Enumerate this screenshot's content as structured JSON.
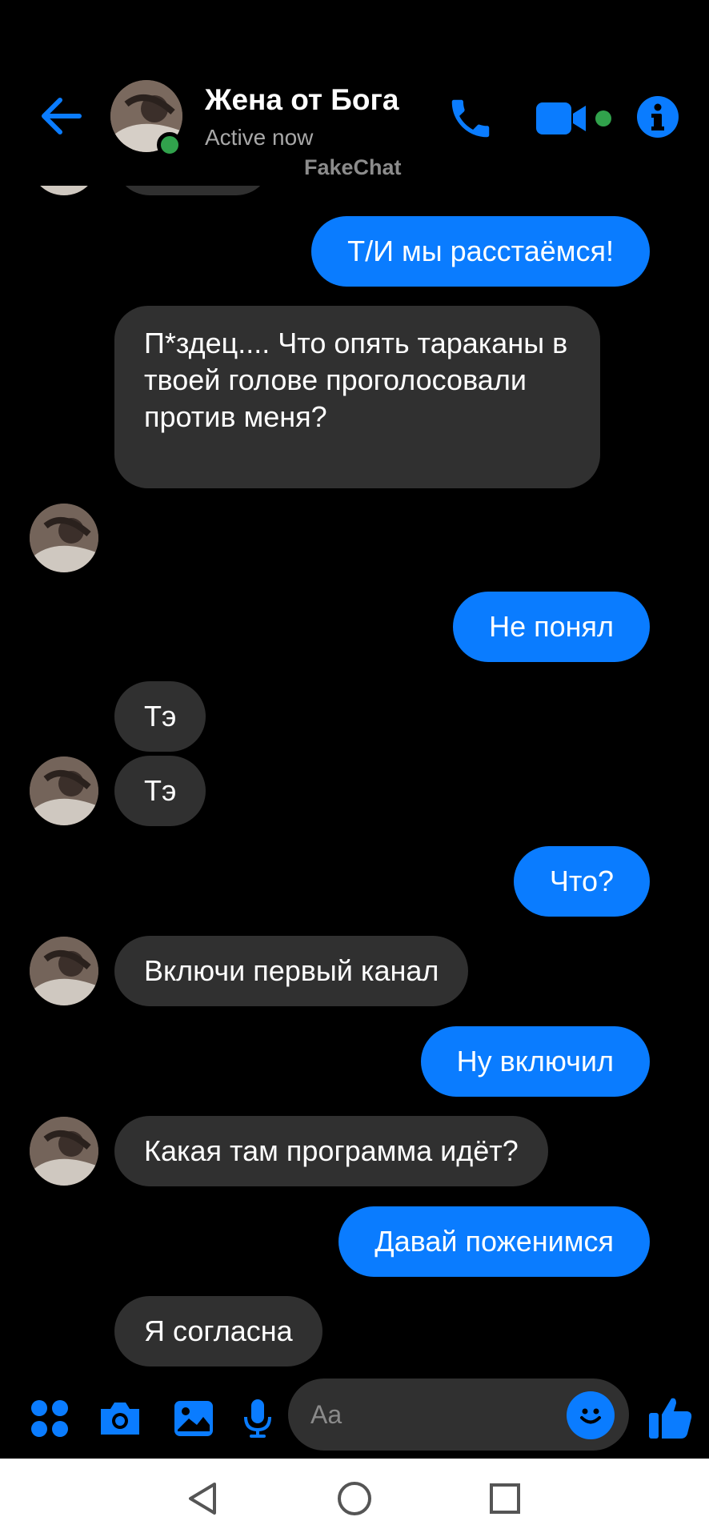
{
  "header": {
    "contact_name": "Жена от Бога",
    "status": "Active now",
    "watermark": "FakeChat"
  },
  "messages": [
    {
      "side": "out",
      "text": "Т/И  мы расстаёмся!"
    },
    {
      "side": "in",
      "text": "П*здец.... Что опять тараканы в твоей голове проголосовали против меня?"
    },
    {
      "side": "in",
      "text": "😂😂😂😂"
    },
    {
      "side": "out",
      "text": "Не понял"
    },
    {
      "side": "in",
      "text": "Тэ"
    },
    {
      "side": "in",
      "text": "Тэ"
    },
    {
      "side": "out",
      "text": "Что?"
    },
    {
      "side": "in",
      "text": "Включи первый канал"
    },
    {
      "side": "out",
      "text": "Ну включил"
    },
    {
      "side": "in",
      "text": "Какая там программа идёт?"
    },
    {
      "side": "out",
      "text": "Давай поженимся"
    },
    {
      "side": "in",
      "text": "Я согласна"
    }
  ],
  "composer": {
    "placeholder": "Aa"
  },
  "colors": {
    "accent": "#0a7cff",
    "incoming_bubble": "#303030",
    "online": "#31a24c",
    "background": "#000000"
  },
  "icons": [
    "back-arrow-icon",
    "phone-icon",
    "video-camera-icon",
    "info-icon",
    "apps-grid-icon",
    "camera-icon",
    "gallery-icon",
    "microphone-icon",
    "emoji-icon",
    "thumbs-up-icon",
    "nav-back-icon",
    "nav-home-icon",
    "nav-recents-icon"
  ]
}
